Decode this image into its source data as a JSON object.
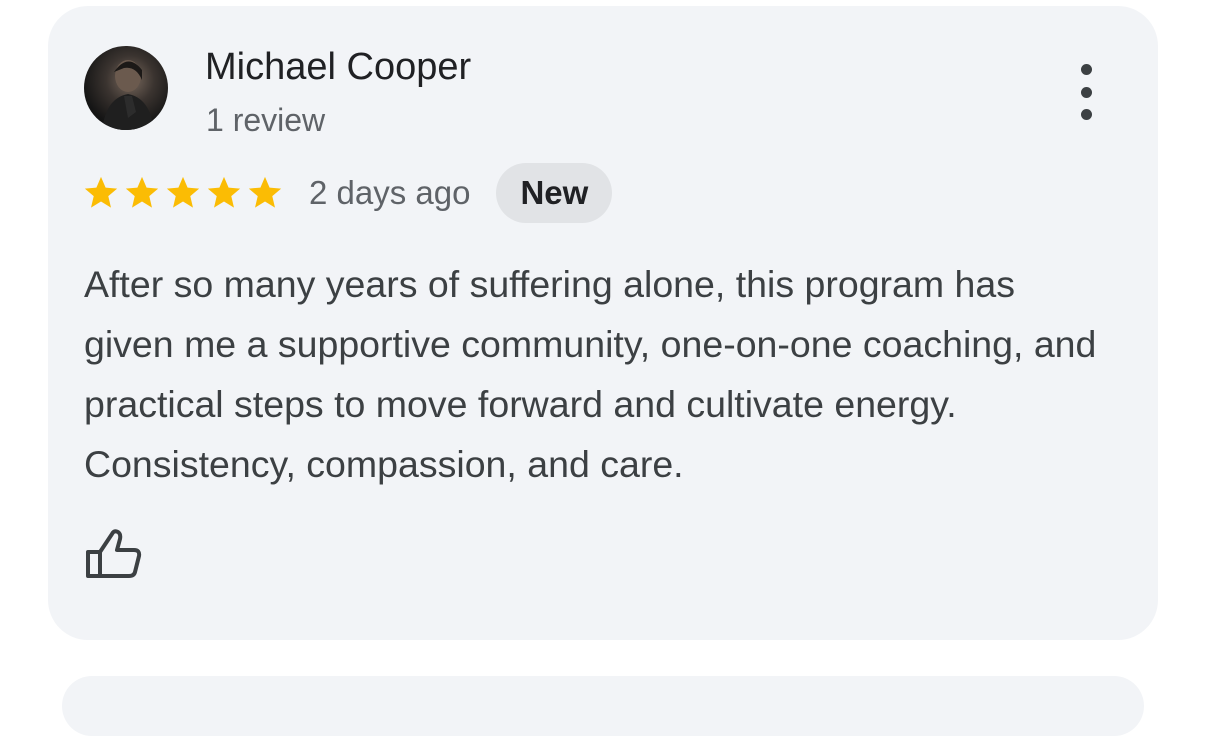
{
  "review": {
    "reviewer_name": "Michael Cooper",
    "review_count": "1 review",
    "rating": 5,
    "max_rating": 5,
    "date": "2 days ago",
    "badge": "New",
    "text": "After so many years of suffering alone, this program has given me a supportive community, one-on-one coaching, and practical steps to move forward and cultivate energy. Consistency, compassion, and care."
  },
  "icons": {
    "menu": "more-vert-icon",
    "like": "thumbs-up-icon",
    "star": "star-icon"
  },
  "colors": {
    "card_background": "#f2f4f7",
    "star": "#fbbc04",
    "badge_background": "#e1e3e6",
    "text_primary": "#202124",
    "text_secondary": "#5f6368"
  }
}
